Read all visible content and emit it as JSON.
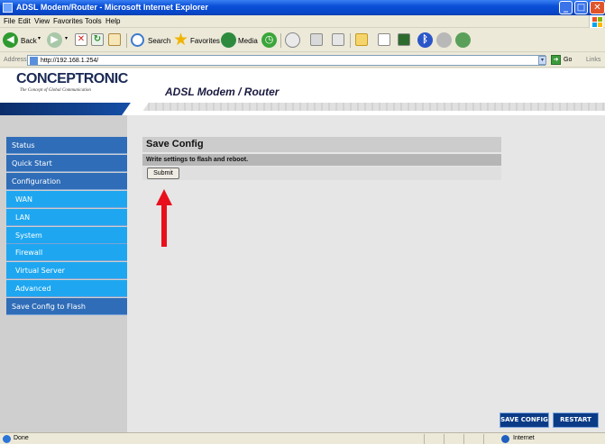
{
  "window": {
    "title": "ADSL Modem/Router - Microsoft Internet Explorer"
  },
  "menu": [
    "File",
    "Edit",
    "View",
    "Favorites",
    "Tools",
    "Help"
  ],
  "toolbar": {
    "back_label": "Back",
    "search_label": "Search",
    "favorites_label": "Favorites",
    "media_label": "Media"
  },
  "address": {
    "label": "Address",
    "url": "http://192.168.1.254/",
    "go_label": "Go",
    "links_label": "Links"
  },
  "header": {
    "brand": "CONCEPTRONIC",
    "tagline": "The Concept of Global Communication",
    "page_heading": "ADSL Modem / Router"
  },
  "nav": {
    "items": [
      {
        "label": "Status",
        "type": "main"
      },
      {
        "label": "Quick Start",
        "type": "main"
      },
      {
        "label": "Configuration",
        "type": "main"
      },
      {
        "label": "WAN",
        "type": "sub"
      },
      {
        "label": "LAN",
        "type": "sub"
      },
      {
        "label": "System",
        "type": "sub"
      },
      {
        "label": "Firewall",
        "type": "sub"
      },
      {
        "label": "Virtual Server",
        "type": "sub"
      },
      {
        "label": "Advanced",
        "type": "sub"
      },
      {
        "label": "Save Config to Flash",
        "type": "main"
      }
    ]
  },
  "panel": {
    "title": "Save Config",
    "description": "Write settings to flash and reboot.",
    "submit_label": "Submit"
  },
  "footer_buttons": {
    "save_config": "SAVE CONFIG",
    "restart": "RESTART"
  },
  "status": {
    "text": "Done",
    "zone": "Internet"
  },
  "colors": {
    "nav_main": "#2f6db8",
    "nav_sub": "#1ea7f0",
    "annotation_arrow": "#e8101c"
  }
}
